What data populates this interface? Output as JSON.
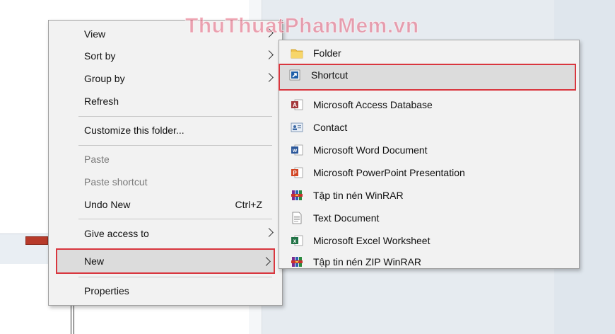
{
  "watermark": "ThuThuatPhanMem.vn",
  "context_menu": {
    "items": [
      {
        "label": "View"
      },
      {
        "label": "Sort by"
      },
      {
        "label": "Group by"
      },
      {
        "label": "Refresh"
      },
      {
        "label": "Customize this folder..."
      },
      {
        "label": "Paste"
      },
      {
        "label": "Paste shortcut"
      },
      {
        "label": "Undo New",
        "shortcut": "Ctrl+Z"
      },
      {
        "label": "Give access to"
      },
      {
        "label": "New"
      },
      {
        "label": "Properties"
      }
    ]
  },
  "new_submenu": {
    "items": [
      {
        "label": "Folder",
        "icon": "folder-icon"
      },
      {
        "label": "Shortcut",
        "icon": "shortcut-icon"
      },
      {
        "label": "Microsoft Access Database",
        "icon": "access-icon"
      },
      {
        "label": "Contact",
        "icon": "contact-icon"
      },
      {
        "label": "Microsoft Word Document",
        "icon": "word-icon"
      },
      {
        "label": "Microsoft PowerPoint Presentation",
        "icon": "powerpoint-icon"
      },
      {
        "label": "Tập tin nén WinRAR",
        "icon": "winrar-icon"
      },
      {
        "label": "Text Document",
        "icon": "text-document-icon"
      },
      {
        "label": "Microsoft Excel Worksheet",
        "icon": "excel-icon"
      },
      {
        "label": "Tập tin nén ZIP WinRAR",
        "icon": "winrar-zip-icon"
      }
    ]
  },
  "colors": {
    "highlight_border": "#d9363e",
    "highlight_fill": "#dcdcdc",
    "menu_bg": "#f2f2f2"
  }
}
